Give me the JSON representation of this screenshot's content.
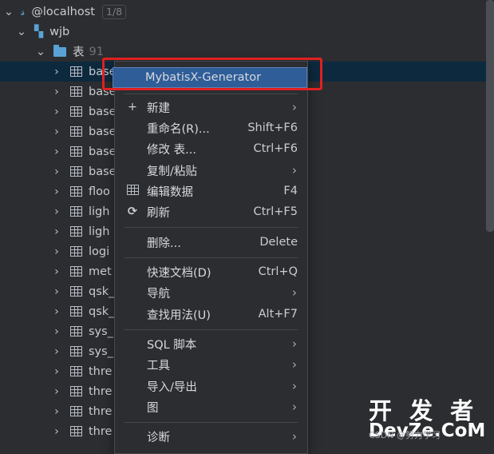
{
  "tree": {
    "server": {
      "label": "@localhost",
      "badge": "1/8"
    },
    "database": {
      "label": "wjb"
    },
    "tables_node": {
      "label": "表",
      "count": "91"
    },
    "rows": [
      "base",
      "base",
      "base",
      "base",
      "base",
      "base",
      "floo",
      "ligh",
      "ligh",
      "logi",
      "met",
      "qsk_",
      "qsk_",
      "sys_",
      "sys_",
      "thre",
      "thre",
      "thre",
      "thre"
    ]
  },
  "menu": {
    "highlight": "MybatisX-Generator",
    "items": [
      {
        "label": "新建",
        "icon": "+",
        "arrow": true
      },
      {
        "label": "重命名(R)...",
        "shortcut": "Shift+F6"
      },
      {
        "label": "修改 表...",
        "shortcut": "Ctrl+F6"
      },
      {
        "label": "复制/粘贴",
        "arrow": true
      },
      {
        "label": "编辑数据",
        "icon": "table",
        "shortcut": "F4"
      },
      {
        "label": "刷新",
        "icon": "refresh",
        "shortcut": "Ctrl+F5"
      },
      {
        "label": "删除...",
        "shortcut": "Delete"
      },
      {
        "label": "快速文档(D)",
        "shortcut": "Ctrl+Q"
      },
      {
        "label": "导航",
        "arrow": true
      },
      {
        "label": "查找用法(U)",
        "shortcut": "Alt+F7"
      },
      {
        "label": "SQL 脚本",
        "arrow": true
      },
      {
        "label": "工具",
        "arrow": true
      },
      {
        "label": "导入/导出",
        "arrow": true
      },
      {
        "label": "图",
        "arrow": true
      },
      {
        "label": "诊断",
        "arrow": true
      }
    ]
  },
  "watermark": {
    "line1": "开 发 者",
    "line2": "DevZe.CoM",
    "line3": "CSDN @努力学习"
  }
}
